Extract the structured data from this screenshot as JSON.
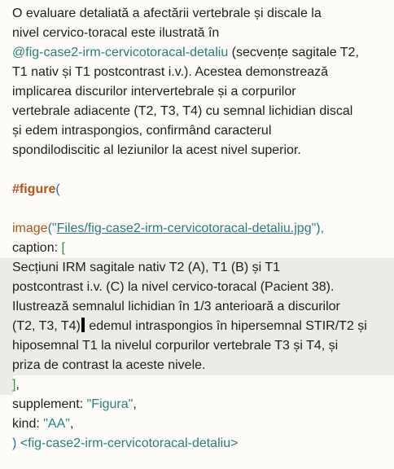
{
  "paragraph": {
    "l1": "O evaluare detaliată a afectării vertebrale și discale la",
    "l2": "nivel cervico-toracal este ilustrată în",
    "l3_ref": "@fig-case2-irm-cervicotoracal-detaliu",
    "l3_rest": " (secvențe sagitale T2,",
    "l4": "T1 nativ și T1 postcontrast i.v.). Acestea demonstrează",
    "l5": "implicarea discurilor intervertebrale și a corpurilor",
    "l6": "vertebrale adiacente (T2, T3, T4) cu semnal lichidian discal",
    "l7": "și edem intraspongios, confirmând caracterul",
    "l8": "spondilodiscitic al leziunilor la acest nivel superior."
  },
  "code": {
    "figure_kw": "#figure",
    "open_paren": "(",
    "image_fn": "image",
    "image_open": "(\"",
    "image_path": "Files/fig-case2-irm-cervicotoracal-detaliu.jpg",
    "image_close": "\"),",
    "caption_key": "caption",
    "caption_sep": ": ",
    "caption_open": "[",
    "cap1": "Secțiuni IRM sagitale nativ T2 (A), T1 (B) și T1",
    "cap2": "postcontrast i.v. (C) la nivel cervico-toracal (Pacient 38).",
    "cap3": "Ilustrează semnalul lichidian în 1/3 anterioară a discurilor",
    "cap4a": "(T2, T3, T4)",
    "cap4b": " edemul intraspongios în hipersemnal STIR/T2 și",
    "cap5": "hiposemnal T1 la nivelul corpurilor vertebrale T3 și T4, și",
    "cap6": "priza de contrast la aceste nivele.",
    "caption_close": "]",
    "caption_comma": ",",
    "supplement_key": "supplement",
    "supplement_sep": ": ",
    "supplement_val": "\"Figura\"",
    "supplement_comma": ",",
    "kind_key": "kind",
    "kind_sep": ": ",
    "kind_val": "\"AA\"",
    "kind_comma": ",",
    "close_paren": ")",
    "label": " <fig-case2-irm-cervicotoracal-detaliu>"
  }
}
